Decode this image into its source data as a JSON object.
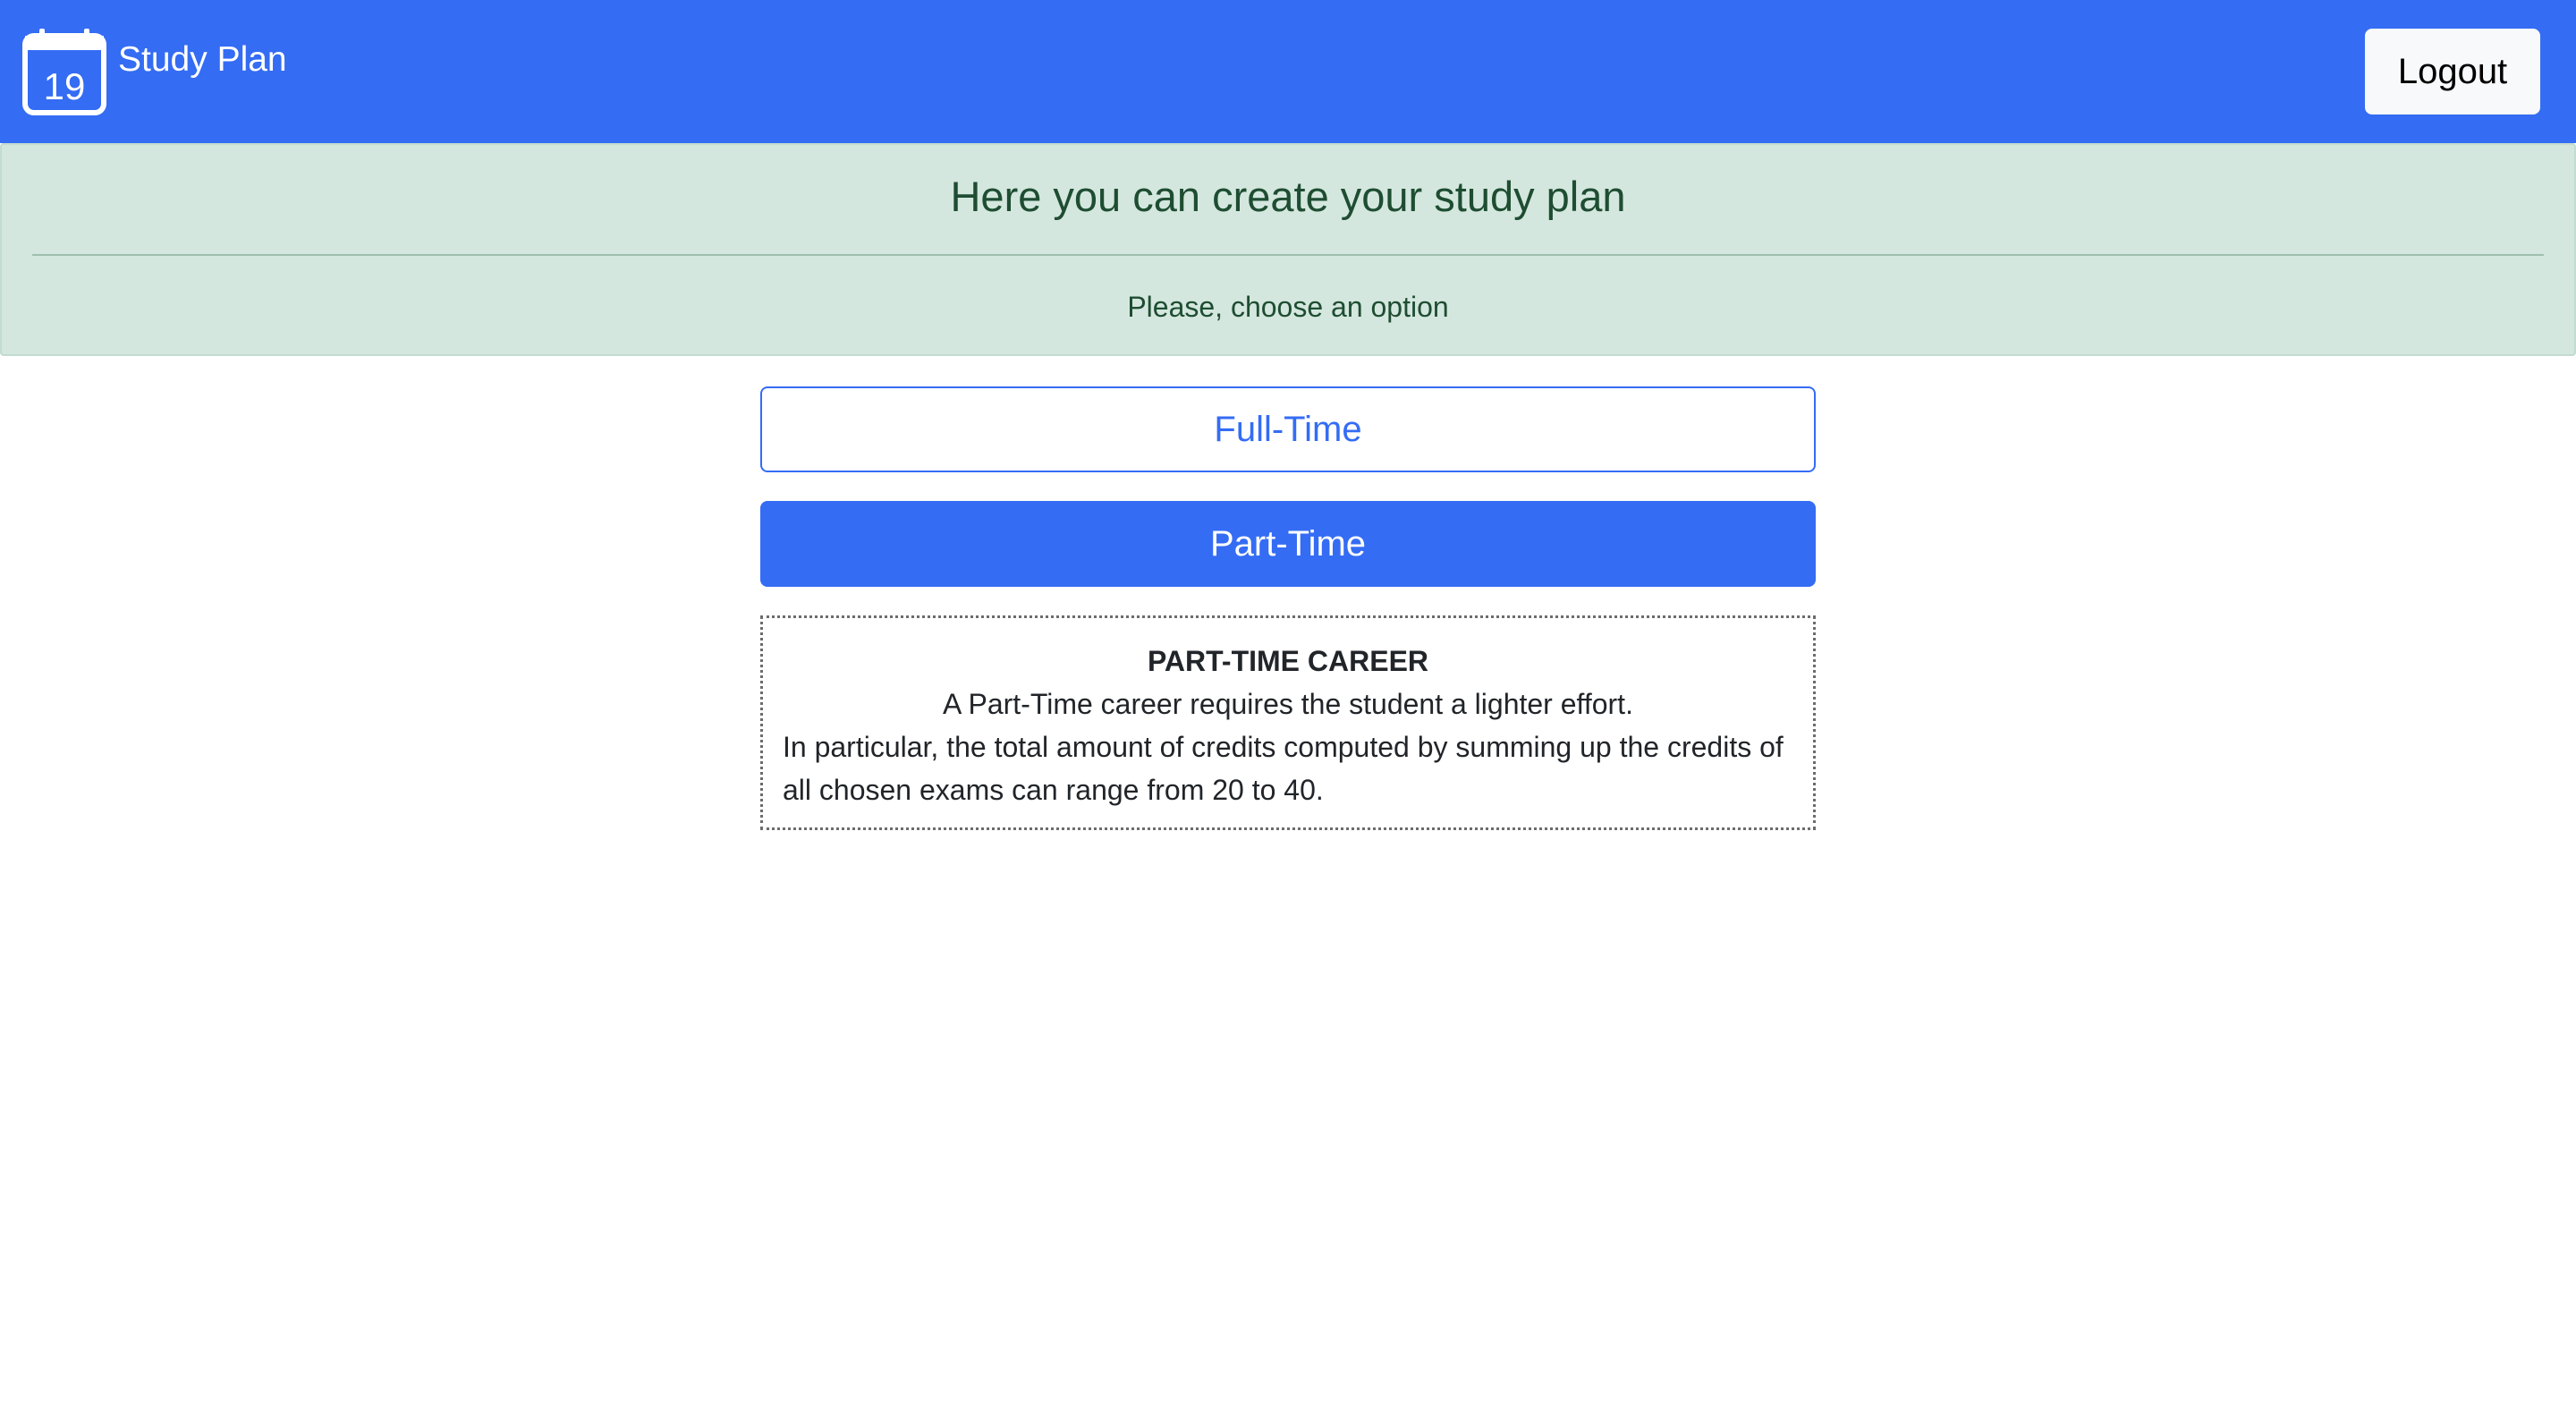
{
  "navbar": {
    "calendar_day": "19",
    "brand": "Study Plan",
    "logout_label": "Logout",
    "color": "#346cf4"
  },
  "alert": {
    "heading": "Here you can create your study plan",
    "subtext": "Please, choose an option"
  },
  "options": {
    "full_time_label": "Full-Time",
    "part_time_label": "Part-Time",
    "selected": "Part-Time"
  },
  "description": {
    "title": "PART-TIME CAREER",
    "line1": "A Part-Time career requires the student a lighter effort.",
    "line2": "In particular, the total amount of credits computed by summing up the credits of all chosen exams can range from 20 to 40."
  },
  "icons": {
    "brand_icon": "calendar-icon"
  }
}
